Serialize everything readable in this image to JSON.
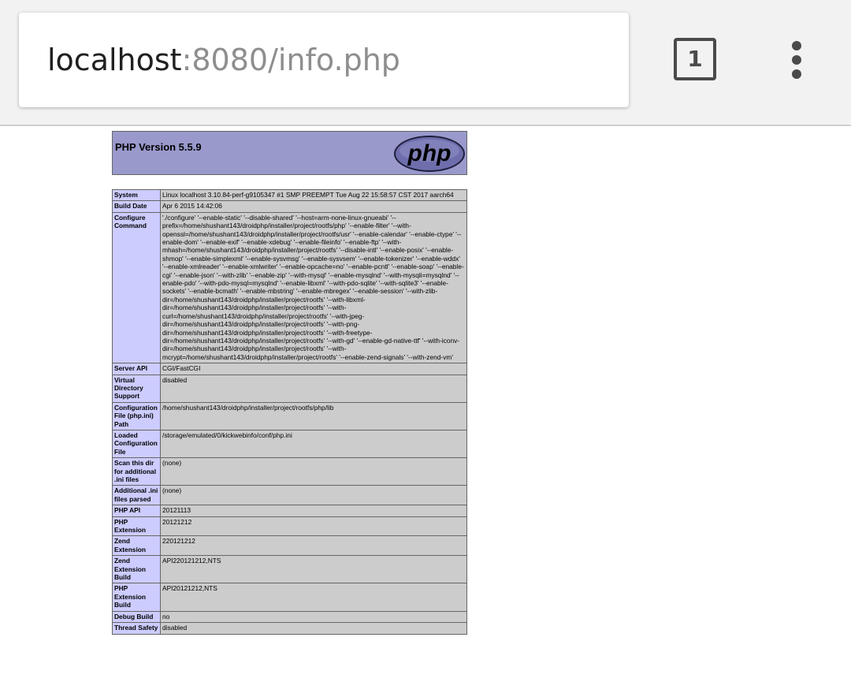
{
  "browser": {
    "url_host": "localhost",
    "url_rest": ":8080/info.php",
    "tab_count": "1",
    "menu_icon": "more-vert-icon"
  },
  "page": {
    "title": "PHP Version 5.5.9",
    "logo_text": "php",
    "colors": {
      "header_bg": "#9999cc",
      "label_bg": "#ccccff",
      "value_bg": "#cccccc"
    },
    "rows": [
      {
        "label": "System",
        "value": "Linux localhost 3.10.84-perf-g9105347 #1 SMP PREEMPT Tue Aug 22 15:58:57 CST 2017 aarch64"
      },
      {
        "label": "Build Date",
        "value": "Apr 6 2015 14:42:06"
      },
      {
        "label": "Configure Command",
        "value": "'./configure' '--enable-static' '--disable-shared' '--host=arm-none-linux-gnueabi' '--prefix=/home/shushant143/droidphp/installer/project/rootfs/php' '--enable-filter' '--with-openssl=/home/shushant143/droidphp/installer/project/rootfs/usr' '--enable-calendar' '--enable-ctype' '--enable-dom' '--enable-exif' '--enable-xdebug' '--enable-fileinfo' '--enable-ftp' '--with-mhash=/home/shushant143/droidphp/installer/project/rootfs' '--disable-intl' '--enable-posix' '--enable-shmop' '--enable-simplexml' '--enable-sysvmsg' '--enable-sysvsem' '--enable-tokenizer' '--enable-wddx' '--enable-xmlreader' '--enable-xmlwriter' '--enable-opcache=no' '--enable-pcntl' '--enable-soap' '--enable-cgi' '--enable-json' '--with-zlib' '--enable-zip' '--with-mysql' '--enable-mysqlnd' '--with-mysqli=mysqlnd' '--enable-pdo' '--with-pdo-mysql=mysqlnd' '--enable-libxml' '--with-pdo-sqlite' '--with-sqlite3' '--enable-sockets' '--enable-bcmath' '--enable-mbstring' '--enable-mbregex' '--enable-session' '--with-zlib-dir=/home/shushant143/droidphp/installer/project/rootfs' '--with-libxml-dir=/home/shushant143/droidphp/installer/project/rootfs' '--with-curl=/home/shushant143/droidphp/installer/project/rootfs' '--with-jpeg-dir=/home/shushant143/droidphp/installer/project/rootfs' '--with-png-dir=/home/shushant143/droidphp/installer/project/rootfs' '--with-freetype-dir=/home/shushant143/droidphp/installer/project/rootfs' '--with-gd' '--enable-gd-native-ttf' '--with-iconv-dir=/home/shushant143/droidphp/installer/project/rootfs' '--with-mcrypt=/home/shushant143/droidphp/installer/project/rootfs' '--enable-zend-signals' '--with-zend-vm'"
      },
      {
        "label": "Server API",
        "value": "CGI/FastCGI"
      },
      {
        "label": "Virtual Directory Support",
        "value": "disabled"
      },
      {
        "label": "Configuration File (php.ini) Path",
        "value": "/home/shushant143/droidphp/installer/project/rootfs/php/lib"
      },
      {
        "label": "Loaded Configuration File",
        "value": "/storage/emulated/0/kickwebinfo/conf/php.ini"
      },
      {
        "label": "Scan this dir for additional .ini files",
        "value": "(none)"
      },
      {
        "label": "Additional .ini files parsed",
        "value": "(none)"
      },
      {
        "label": "PHP API",
        "value": "20121113"
      },
      {
        "label": "PHP Extension",
        "value": "20121212"
      },
      {
        "label": "Zend Extension",
        "value": "220121212"
      },
      {
        "label": "Zend Extension Build",
        "value": "API220121212,NTS"
      },
      {
        "label": "PHP Extension Build",
        "value": "API20121212,NTS"
      },
      {
        "label": "Debug Build",
        "value": "no"
      },
      {
        "label": "Thread Safety",
        "value": "disabled"
      }
    ]
  }
}
